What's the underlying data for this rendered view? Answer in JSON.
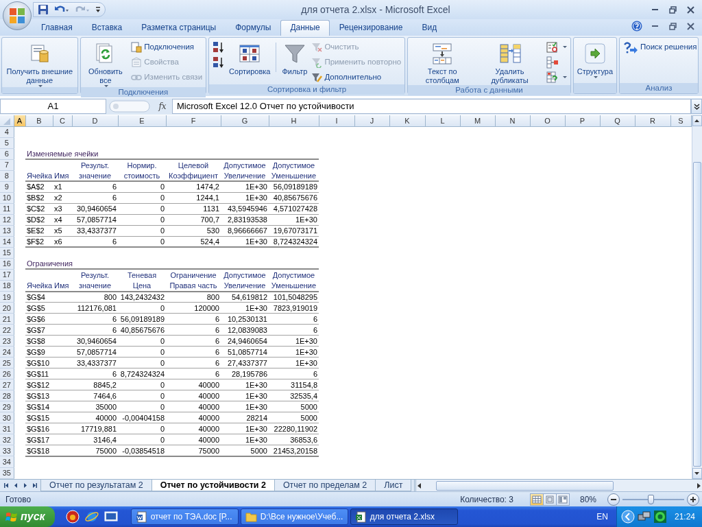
{
  "window": {
    "title": "для отчета 2.xlsx - Microsoft Excel"
  },
  "ribbon_tabs": [
    {
      "label": "Главная",
      "selected": false
    },
    {
      "label": "Вставка",
      "selected": false
    },
    {
      "label": "Разметка страницы",
      "selected": false
    },
    {
      "label": "Формулы",
      "selected": false
    },
    {
      "label": "Данные",
      "selected": true
    },
    {
      "label": "Рецензирование",
      "selected": false
    },
    {
      "label": "Вид",
      "selected": false
    }
  ],
  "ribbon_groups": [
    {
      "buttons": [
        {
          "kind": "large",
          "label": "Получить внешние данные",
          "dropdown": true,
          "disabled": false
        }
      ]
    },
    {
      "label": "Подключения",
      "buttons": [
        {
          "kind": "large",
          "label": "Обновить все",
          "dropdown": true,
          "disabled": false
        },
        {
          "kind": "small",
          "label": "Подключения",
          "dropdown": false,
          "disabled": false
        },
        {
          "kind": "small",
          "label": "Свойства",
          "dropdown": false,
          "disabled": true
        },
        {
          "kind": "small",
          "label": "Изменить связи",
          "dropdown": false,
          "disabled": true
        }
      ]
    },
    {
      "label": "Сортировка и фильтр",
      "buttons": [
        {
          "kind": "icon",
          "dropdown": false,
          "disabled": false
        },
        {
          "kind": "icon",
          "dropdown": false,
          "disabled": false
        },
        {
          "kind": "large",
          "label": "Сортировка",
          "dropdown": false,
          "disabled": false
        },
        {
          "kind": "large",
          "label": "Фильтр",
          "dropdown": false,
          "disabled": false
        },
        {
          "kind": "small",
          "label": "Очистить",
          "dropdown": false,
          "disabled": true
        },
        {
          "kind": "small",
          "label": "Применить повторно",
          "dropdown": false,
          "disabled": true
        },
        {
          "kind": "small",
          "label": "Дополнительно",
          "dropdown": false,
          "disabled": false
        }
      ]
    },
    {
      "label": "Работа с данными",
      "buttons": [
        {
          "kind": "large",
          "label": "Текст по столбцам",
          "dropdown": false,
          "disabled": false
        },
        {
          "kind": "large",
          "label": "Удалить дубликаты",
          "dropdown": false,
          "disabled": false
        },
        {
          "kind": "icon",
          "dropdown": true,
          "disabled": false
        },
        {
          "kind": "icon",
          "dropdown": false,
          "disabled": false
        },
        {
          "kind": "icon",
          "dropdown": true,
          "disabled": false
        }
      ]
    },
    {
      "buttons": [
        {
          "kind": "large",
          "label": "Структура",
          "dropdown": true,
          "disabled": false
        }
      ]
    },
    {
      "label": "Анализ",
      "buttons": [
        {
          "kind": "small",
          "label": "Поиск решения",
          "dropdown": false,
          "disabled": false
        }
      ]
    }
  ],
  "formula_bar": {
    "name_box": "A1",
    "function_label": "fx",
    "formula": "Microsoft Excel 12.0 Отчет по устойчивости"
  },
  "sheet": {
    "columns": [
      {
        "label": "A",
        "selected": true
      },
      {
        "label": "B",
        "selected": false
      },
      {
        "label": "C",
        "selected": false
      },
      {
        "label": "D",
        "selected": false
      },
      {
        "label": "E",
        "selected": false
      },
      {
        "label": "F",
        "selected": false
      },
      {
        "label": "G",
        "selected": false
      },
      {
        "label": "H",
        "selected": false
      },
      {
        "label": "I",
        "selected": false
      },
      {
        "label": "J",
        "selected": false
      },
      {
        "label": "K",
        "selected": false
      },
      {
        "label": "L",
        "selected": false
      },
      {
        "label": "M",
        "selected": false
      },
      {
        "label": "N",
        "selected": false
      },
      {
        "label": "O",
        "selected": false
      },
      {
        "label": "P",
        "selected": false
      },
      {
        "label": "Q",
        "selected": false
      },
      {
        "label": "R",
        "selected": false
      },
      {
        "label": "S",
        "selected": false
      }
    ],
    "rows": [
      {
        "number": "4",
        "kind": "blank"
      },
      {
        "number": "5",
        "kind": "blank"
      },
      {
        "number": "6",
        "kind": "section",
        "title": "Изменяемые ячейки"
      },
      {
        "number": "7",
        "kind": "head",
        "cells": [
          null,
          null,
          "Результ.",
          "Нормир.",
          "Целевой",
          "Допустимое",
          "Допустимое"
        ]
      },
      {
        "number": "8",
        "kind": "head",
        "cells": [
          "Ячейка",
          "Имя",
          "значение",
          "стоимость",
          "Коэффициент",
          "Увеличение",
          "Уменьшение"
        ]
      },
      {
        "number": "9",
        "kind": "data",
        "cells": [
          "$A$2",
          "x1",
          "6",
          "0",
          "1474,2",
          "1E+30",
          "56,09189189"
        ]
      },
      {
        "number": "10",
        "kind": "data",
        "cells": [
          "$B$2",
          "x2",
          "6",
          "0",
          "1244,1",
          "1E+30",
          "40,85675676"
        ]
      },
      {
        "number": "11",
        "kind": "data",
        "cells": [
          "$C$2",
          "x3",
          "30,9460654",
          "0",
          "1131",
          "43,5945946",
          "4,571027428"
        ]
      },
      {
        "number": "12",
        "kind": "data",
        "cells": [
          "$D$2",
          "x4",
          "57,0857714",
          "0",
          "700,7",
          "2,83193538",
          "1E+30"
        ]
      },
      {
        "number": "13",
        "kind": "data",
        "cells": [
          "$E$2",
          "x5",
          "33,4337377",
          "0",
          "530",
          "8,96666667",
          "19,67073171"
        ]
      },
      {
        "number": "14",
        "kind": "data",
        "cells": [
          "$F$2",
          "x6",
          "6",
          "0",
          "524,4",
          "1E+30",
          "8,724324324"
        ]
      },
      {
        "number": "15",
        "kind": "blank"
      },
      {
        "number": "16",
        "kind": "section",
        "title": "Ограничения"
      },
      {
        "number": "17",
        "kind": "head",
        "cells": [
          null,
          null,
          "Результ.",
          "Теневая",
          "Ограничение",
          "Допустимое",
          "Допустимое"
        ]
      },
      {
        "number": "18",
        "kind": "head",
        "cells": [
          "Ячейка",
          "Имя",
          "значение",
          "Цена",
          "Правая часть",
          "Увеличение",
          "Уменьшение"
        ]
      },
      {
        "number": "19",
        "kind": "data",
        "cells": [
          "$G$4",
          null,
          "800",
          "143,2432432",
          "800",
          "54,619812",
          "101,5048295"
        ]
      },
      {
        "number": "20",
        "kind": "data",
        "cells": [
          "$G$5",
          null,
          "112176,081",
          "0",
          "120000",
          "1E+30",
          "7823,919019"
        ]
      },
      {
        "number": "21",
        "kind": "data",
        "cells": [
          "$G$6",
          null,
          "6",
          "56,09189189",
          "6",
          "10,2530131",
          "6"
        ]
      },
      {
        "number": "22",
        "kind": "data",
        "cells": [
          "$G$7",
          null,
          "6",
          "40,85675676",
          "6",
          "12,0839083",
          "6"
        ]
      },
      {
        "number": "23",
        "kind": "data",
        "cells": [
          "$G$8",
          null,
          "30,9460654",
          "0",
          "6",
          "24,9460654",
          "1E+30"
        ]
      },
      {
        "number": "24",
        "kind": "data",
        "cells": [
          "$G$9",
          null,
          "57,0857714",
          "0",
          "6",
          "51,0857714",
          "1E+30"
        ]
      },
      {
        "number": "25",
        "kind": "data",
        "cells": [
          "$G$10",
          null,
          "33,4337377",
          "0",
          "6",
          "27,4337377",
          "1E+30"
        ]
      },
      {
        "number": "26",
        "kind": "data",
        "cells": [
          "$G$11",
          null,
          "6",
          "8,724324324",
          "6",
          "28,195786",
          "6"
        ]
      },
      {
        "number": "27",
        "kind": "data",
        "cells": [
          "$G$12",
          null,
          "8845,2",
          "0",
          "40000",
          "1E+30",
          "31154,8"
        ]
      },
      {
        "number": "28",
        "kind": "data",
        "cells": [
          "$G$13",
          null,
          "7464,6",
          "0",
          "40000",
          "1E+30",
          "32535,4"
        ]
      },
      {
        "number": "29",
        "kind": "data",
        "cells": [
          "$G$14",
          null,
          "35000",
          "0",
          "40000",
          "1E+30",
          "5000"
        ]
      },
      {
        "number": "30",
        "kind": "data",
        "cells": [
          "$G$15",
          null,
          "40000",
          "-0,00404158",
          "40000",
          "28214",
          "5000"
        ]
      },
      {
        "number": "31",
        "kind": "data",
        "cells": [
          "$G$16",
          null,
          "17719,881",
          "0",
          "40000",
          "1E+30",
          "22280,11902"
        ]
      },
      {
        "number": "32",
        "kind": "data",
        "cells": [
          "$G$17",
          null,
          "3146,4",
          "0",
          "40000",
          "1E+30",
          "36853,6"
        ]
      },
      {
        "number": "33",
        "kind": "data",
        "cells": [
          "$G$18",
          null,
          "75000",
          "-0,03854518",
          "75000",
          "5000",
          "21453,20158"
        ]
      },
      {
        "number": "34",
        "kind": "blank"
      },
      {
        "number": "35",
        "kind": "blank"
      }
    ]
  },
  "sheet_tabs": [
    {
      "label": "Отчет по результатам 2",
      "selected": false
    },
    {
      "label": "Отчет по устойчивости 2",
      "selected": true
    },
    {
      "label": "Отчет по пределам 2",
      "selected": false
    },
    {
      "label": "Лист",
      "selected": false
    }
  ],
  "status_bar": {
    "status": "Готово",
    "count": "Количество: 3",
    "views": [
      {
        "selected": true
      },
      {
        "selected": false
      },
      {
        "selected": false
      }
    ],
    "zoom": "80%",
    "zoom_slider": {
      "level": 0.45
    }
  },
  "taskbar": {
    "start": "пуск",
    "tasks": [
      {
        "label": "отчет по ТЭА.doc [Р...",
        "selected": false
      },
      {
        "label": "D:\\Все нужное\\Учеб...",
        "selected": false
      },
      {
        "label": "для отчета 2.xlsx",
        "selected": true
      }
    ],
    "language": "EN",
    "clock": "21:24"
  }
}
